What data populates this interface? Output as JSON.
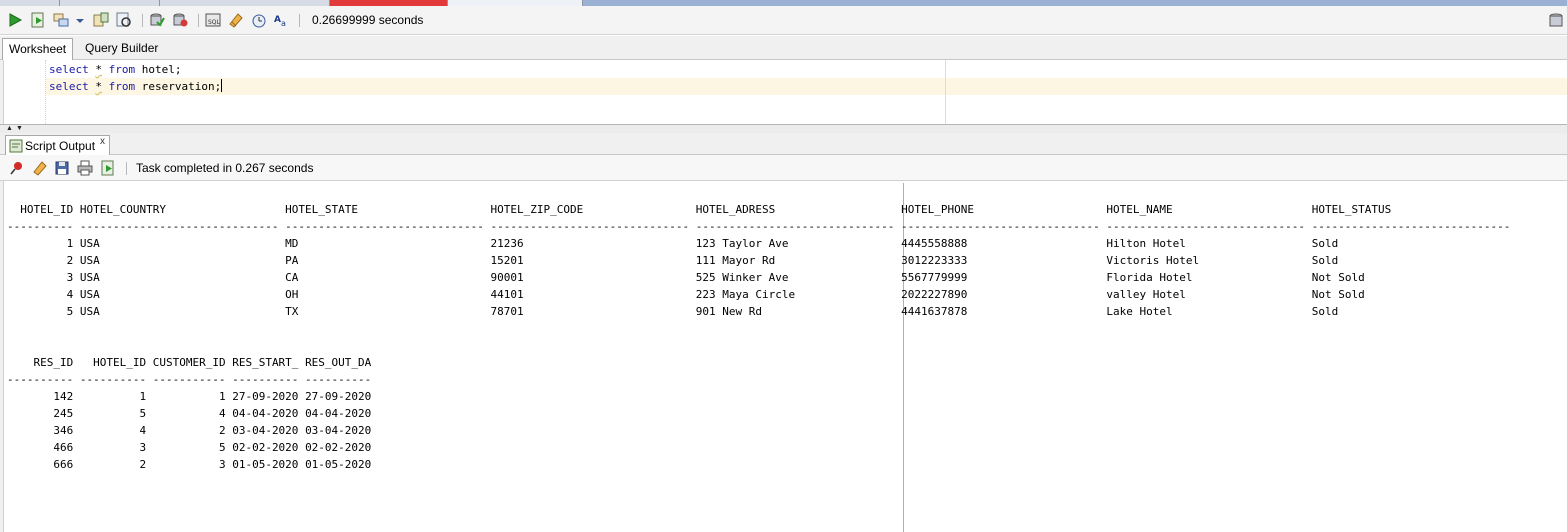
{
  "toolbar": {
    "icons": [
      "run-statement-icon",
      "run-script-icon",
      "explain-plan-icon",
      "dropdown-arrow-icon",
      "autotrace-icon",
      "sql-tuning-icon",
      "commit-icon",
      "rollback-icon",
      "sql-history-icon",
      "clear-icon",
      "unshared-sql-worksheet-icon",
      "format-icon",
      "connection-icon"
    ],
    "timing": "0.26699999 seconds"
  },
  "tabs": {
    "worksheet": "Worksheet",
    "query_builder": "Query Builder"
  },
  "editor": {
    "lines": [
      {
        "kw1": "select",
        "star": "*",
        "kw2": "from",
        "rest": "hotel;"
      },
      {
        "kw1": "select",
        "star": "*",
        "kw2": "from",
        "rest": "reservation;"
      }
    ]
  },
  "output_panel": {
    "tab_label": "Script Output",
    "close": "x",
    "icons": [
      "pin-icon",
      "eraser-icon",
      "save-icon",
      "print-icon",
      "export-icon"
    ],
    "status": "Task completed in 0.267 seconds"
  },
  "results": {
    "hotel": {
      "columns": [
        "HOTEL_ID",
        "HOTEL_COUNTRY",
        "HOTEL_STATE",
        "HOTEL_ZIP_CODE",
        "HOTEL_ADRESS",
        "HOTEL_PHONE",
        "HOTEL_NAME",
        "HOTEL_STATUS"
      ],
      "rows": [
        [
          "1",
          "USA",
          "MD",
          "21236",
          "123 Taylor Ave",
          "4445558888",
          "Hilton Hotel",
          "Sold"
        ],
        [
          "2",
          "USA",
          "PA",
          "15201",
          "111 Mayor Rd",
          "3012223333",
          "Victoris Hotel",
          "Sold"
        ],
        [
          "3",
          "USA",
          "CA",
          "90001",
          "525 Winker Ave",
          "5567779999",
          "Florida Hotel",
          "Not Sold"
        ],
        [
          "4",
          "USA",
          "OH",
          "44101",
          "223 Maya Circle",
          "2022227890",
          "valley Hotel",
          "Not Sold"
        ],
        [
          "5",
          "USA",
          "TX",
          "78701",
          "901 New Rd",
          "4441637878",
          "Lake Hotel",
          "Sold"
        ]
      ]
    },
    "reservation": {
      "columns": [
        "RES_ID",
        "HOTEL_ID",
        "CUSTOMER_ID",
        "RES_START_",
        "RES_OUT_DA"
      ],
      "rows": [
        [
          "142",
          "1",
          "1",
          "27-09-2020",
          "27-09-2020"
        ],
        [
          "245",
          "5",
          "4",
          "04-04-2020",
          "04-04-2020"
        ],
        [
          "346",
          "4",
          "2",
          "03-04-2020",
          "03-04-2020"
        ],
        [
          "466",
          "3",
          "5",
          "02-02-2020",
          "02-02-2020"
        ],
        [
          "666",
          "2",
          "3",
          "01-05-2020",
          "01-05-2020"
        ]
      ]
    }
  }
}
